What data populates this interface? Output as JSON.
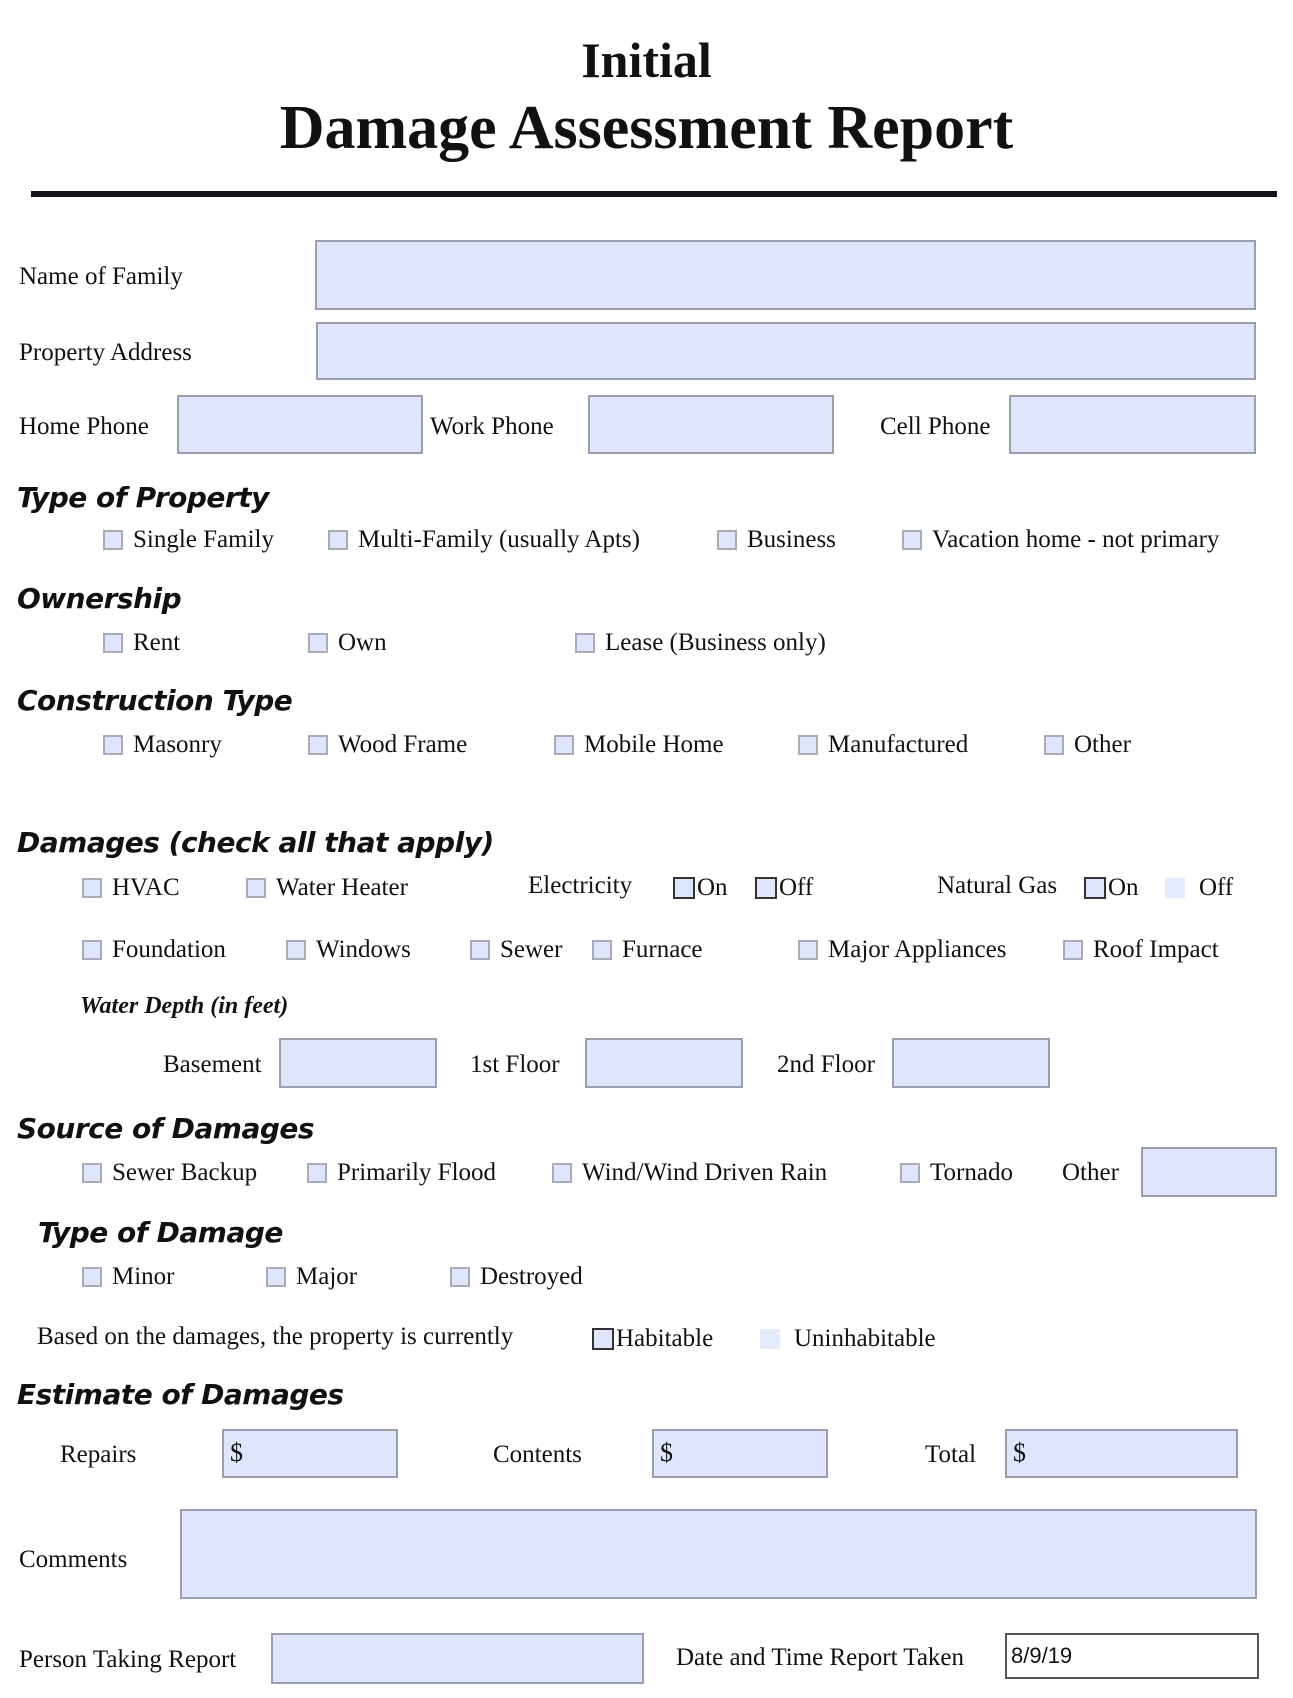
{
  "header": {
    "title_line1": "Initial",
    "title_line2": "Damage Assessment Report"
  },
  "contact": {
    "name_of_family": {
      "label": "Name of Family",
      "value": ""
    },
    "property_address": {
      "label": "Property Address",
      "value": ""
    },
    "home_phone": {
      "label": "Home Phone",
      "value": ""
    },
    "work_phone": {
      "label": "Work Phone",
      "value": ""
    },
    "cell_phone": {
      "label": "Cell Phone",
      "value": ""
    }
  },
  "type_of_property": {
    "heading": "Type of Property",
    "options": [
      {
        "label": "Single Family",
        "checked": false
      },
      {
        "label": "Multi-Family (usually Apts)",
        "checked": false
      },
      {
        "label": "Business",
        "checked": false
      },
      {
        "label": "Vacation home - not primary",
        "checked": false
      }
    ]
  },
  "ownership": {
    "heading": "Ownership",
    "options": [
      {
        "label": "Rent",
        "checked": false
      },
      {
        "label": "Own",
        "checked": false
      },
      {
        "label": "Lease (Business only)",
        "checked": false
      }
    ]
  },
  "construction_type": {
    "heading": "Construction Type",
    "options": [
      {
        "label": "Masonry",
        "checked": false
      },
      {
        "label": "Wood Frame",
        "checked": false
      },
      {
        "label": "Mobile Home",
        "checked": false
      },
      {
        "label": "Manufactured",
        "checked": false
      },
      {
        "label": "Other",
        "checked": false
      }
    ]
  },
  "damages": {
    "heading": "Damages (check all that apply)",
    "row1": [
      {
        "label": "HVAC",
        "checked": false
      },
      {
        "label": "Water Heater",
        "checked": false
      }
    ],
    "electricity": {
      "label": "Electricity",
      "on": "On",
      "off": "Off"
    },
    "natural_gas": {
      "label": "Natural Gas",
      "on": "On",
      "off": "Off"
    },
    "row2": [
      {
        "label": "Foundation",
        "checked": false
      },
      {
        "label": "Windows",
        "checked": false
      },
      {
        "label": "Sewer",
        "checked": false
      },
      {
        "label": "Furnace",
        "checked": false
      },
      {
        "label": "Major Appliances",
        "checked": false
      },
      {
        "label": "Roof Impact",
        "checked": false
      }
    ],
    "water_depth": {
      "heading": "Water Depth (in feet)",
      "basement": {
        "label": "Basement",
        "value": ""
      },
      "first_floor": {
        "label": "1st Floor",
        "value": ""
      },
      "second_floor": {
        "label": "2nd Floor",
        "value": ""
      }
    }
  },
  "source_of_damages": {
    "heading": "Source of Damages",
    "options": [
      {
        "label": "Sewer Backup",
        "checked": false
      },
      {
        "label": "Primarily Flood",
        "checked": false
      },
      {
        "label": "Wind/Wind Driven Rain",
        "checked": false
      },
      {
        "label": "Tornado",
        "checked": false
      }
    ],
    "other": {
      "label": "Other",
      "value": ""
    }
  },
  "type_of_damage": {
    "heading": "Type of Damage",
    "options": [
      {
        "label": "Minor",
        "checked": false
      },
      {
        "label": "Major",
        "checked": false
      },
      {
        "label": "Destroyed",
        "checked": false
      }
    ]
  },
  "habitability": {
    "prompt": "Based on the damages, the property is currently",
    "habitable": "Habitable",
    "uninhabitable": "Uninhabitable"
  },
  "estimate": {
    "heading": "Estimate of Damages",
    "currency_symbol": "$",
    "repairs": {
      "label": "Repairs",
      "value": ""
    },
    "contents": {
      "label": "Contents",
      "value": ""
    },
    "total": {
      "label": "Total",
      "value": ""
    }
  },
  "comments": {
    "label": "Comments",
    "value": ""
  },
  "person_taking_report": {
    "label": "Person Taking Report",
    "value": ""
  },
  "date_time_taken": {
    "label": "Date and Time Report Taken",
    "value": "8/9/19"
  },
  "colors": {
    "field_fill": "#dfe6fb",
    "field_border": "#9a9eb0",
    "rule": "#14141e"
  }
}
